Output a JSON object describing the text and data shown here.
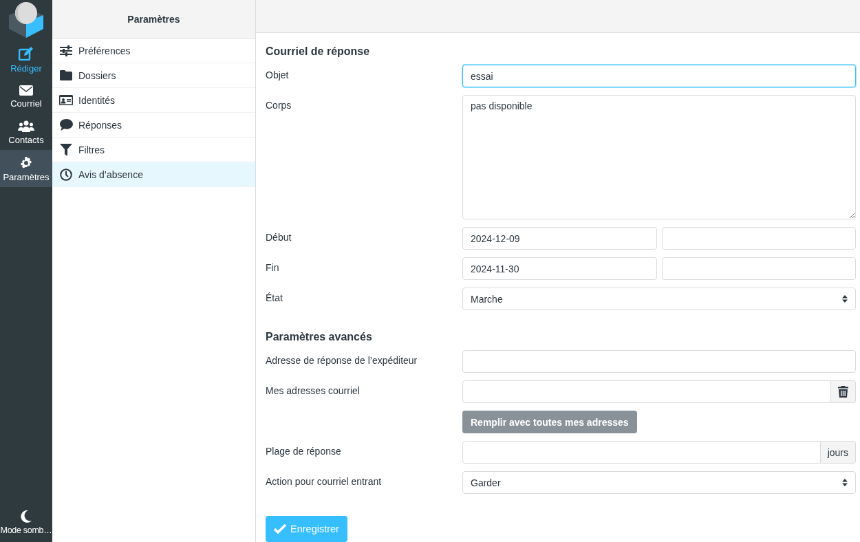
{
  "rail": {
    "items": [
      {
        "label": "Rédiger",
        "accent": true,
        "selected": false
      },
      {
        "label": "Courriel",
        "accent": false,
        "selected": false
      },
      {
        "label": "Contacts",
        "accent": false,
        "selected": false
      },
      {
        "label": "Paramètres",
        "accent": false,
        "selected": true
      }
    ],
    "footer": {
      "label": "Mode somb…"
    }
  },
  "settings": {
    "title": "Paramètres",
    "items": [
      {
        "label": "Préférences",
        "selected": false
      },
      {
        "label": "Dossiers",
        "selected": false
      },
      {
        "label": "Identités",
        "selected": false
      },
      {
        "label": "Réponses",
        "selected": false
      },
      {
        "label": "Filtres",
        "selected": false
      },
      {
        "label": "Avis d’absence",
        "selected": true
      }
    ]
  },
  "form": {
    "sections": [
      {
        "title": "Courriel de réponse",
        "rows": [
          {
            "kind": "input",
            "label": "Objet",
            "value": "essai",
            "focused": true
          },
          {
            "kind": "textarea",
            "label": "Corps",
            "value": "pas disponible"
          },
          {
            "kind": "datetime",
            "label": "Début",
            "value": "2024-12-09"
          },
          {
            "kind": "datetime",
            "label": "Fin",
            "value": "2024-11-30"
          },
          {
            "kind": "select",
            "label": "État",
            "value": "Marche"
          }
        ]
      },
      {
        "title": "Paramètres avancés",
        "rows": [
          {
            "kind": "input",
            "label": "Adresse de réponse de l’expéditeur",
            "focused": false
          },
          {
            "kind": "input-trash",
            "label": "Mes adresses courriel"
          },
          {
            "kind": "action",
            "label": "Remplir avec toutes mes adresses"
          },
          {
            "kind": "input-addon",
            "label": "Plage de réponse",
            "addon": "jours"
          },
          {
            "kind": "select",
            "label": "Action pour courriel entrant",
            "value": "Garder"
          }
        ]
      }
    ],
    "submit": "Enregistrer"
  }
}
